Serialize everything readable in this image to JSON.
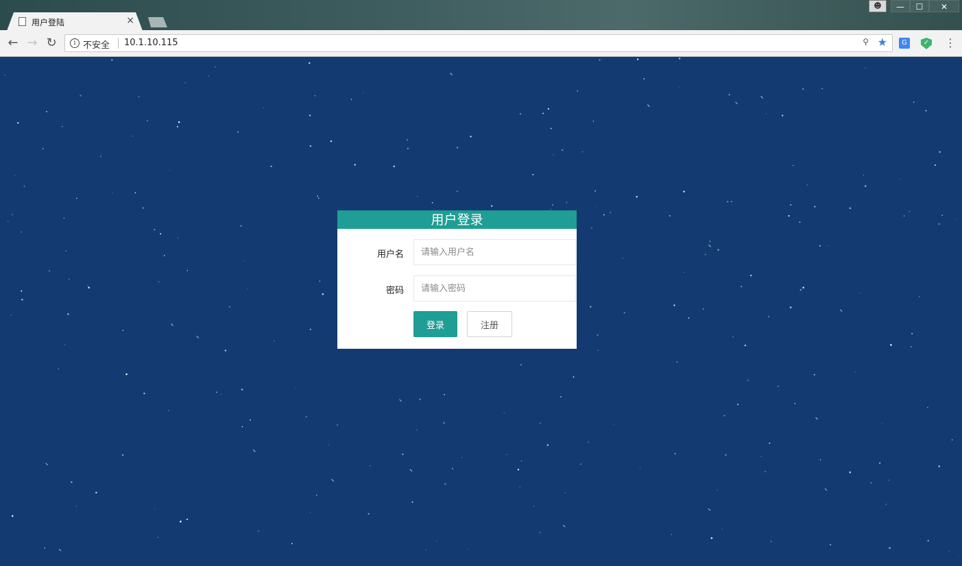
{
  "browser": {
    "tab_title": "用户登陆",
    "tab_close": "×",
    "security_label": "不安全",
    "url": "10.1.10.115",
    "icons": {
      "back": "arrow-left-icon",
      "forward": "arrow-right-icon",
      "reload": "reload-icon",
      "info": "info-icon",
      "key": "key-icon",
      "bookmark": "star-icon",
      "translate": "google-translate-icon",
      "shield": "shield-extension-icon",
      "menu": "kebab-menu-icon"
    }
  },
  "window": {
    "minimize": "—",
    "maximize": "☐",
    "close": "✕"
  },
  "login": {
    "title": "用户登录",
    "username_label": "用户名",
    "username_placeholder": "请输入用户名",
    "username_value": "",
    "password_label": "密码",
    "password_placeholder": "请输入密码",
    "password_value": "",
    "login_button": "登录",
    "register_button": "注册"
  },
  "colors": {
    "page_background": "#143b71",
    "accent": "#1e9e94",
    "star": "#ffffff"
  }
}
